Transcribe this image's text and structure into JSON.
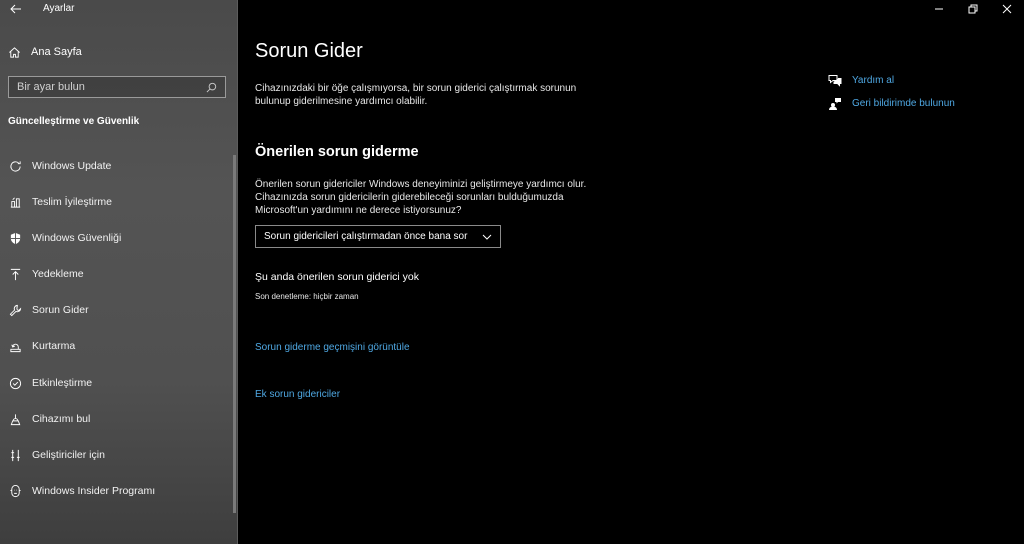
{
  "app": {
    "title": "Ayarlar"
  },
  "sidebar": {
    "home_label": "Ana Sayfa",
    "search": {
      "placeholder": "Bir ayar bulun"
    },
    "section_title": "Güncelleştirme ve Güvenlik",
    "items": [
      {
        "label": "Windows Update",
        "icon": "refresh-icon"
      },
      {
        "label": "Teslim İyileştirme",
        "icon": "delivery-optimization-icon"
      },
      {
        "label": "Windows Güvenliği",
        "icon": "shield-icon"
      },
      {
        "label": "Yedekleme",
        "icon": "backup-upload-icon"
      },
      {
        "label": "Sorun Gider",
        "icon": "wrench-icon"
      },
      {
        "label": "Kurtarma",
        "icon": "recovery-icon"
      },
      {
        "label": "Etkinleştirme",
        "icon": "check-circle-icon"
      },
      {
        "label": "Cihazımı bul",
        "icon": "find-device-icon"
      },
      {
        "label": "Geliştiriciler için",
        "icon": "developer-icon"
      },
      {
        "label": "Windows Insider Programı",
        "icon": "insider-icon"
      }
    ]
  },
  "main": {
    "title": "Sorun Gider",
    "intro": "Cihazınızdaki bir öğe çalışmıyorsa, bir sorun giderici çalıştırmak sorunun bulunup giderilmesine yardımcı olabilir.",
    "recommended_heading": "Önerilen sorun giderme",
    "recommended_desc": "Önerilen sorun gidericiler Windows deneyiminizi geliştirmeye yardımcı olur. Cihazınızda sorun gidericilerin giderebileceği sorunları bulduğumuzda Microsoft'un yardımını ne derece istiyorsunuz?",
    "dropdown_value": "Sorun gidericileri çalıştırmadan önce bana sor",
    "status": "Şu anda önerilen sorun giderici yok",
    "last_check": "Son denetleme: hiçbir zaman",
    "history_link": "Sorun giderme geçmişini görüntüle",
    "additional_link": "Ek sorun gidericiler"
  },
  "help": {
    "get_help": "Yardım al",
    "feedback": "Geri bildirimde bulunun"
  },
  "colors": {
    "accent_link": "#4fa8e3",
    "sidebar_bg": "#505050",
    "main_bg": "#000000"
  }
}
